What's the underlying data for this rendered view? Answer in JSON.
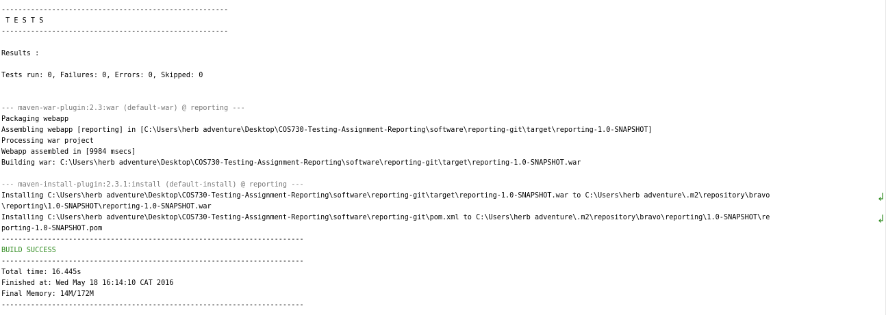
{
  "console": {
    "lines": [
      {
        "text": "------------------------------------------------------",
        "style": "normal"
      },
      {
        "text": " T E S T S",
        "style": "normal"
      },
      {
        "text": "------------------------------------------------------",
        "style": "normal"
      },
      {
        "text": "",
        "style": "normal"
      },
      {
        "text": "Results :",
        "style": "normal"
      },
      {
        "text": "",
        "style": "normal"
      },
      {
        "text": "Tests run: 0, Failures: 0, Errors: 0, Skipped: 0",
        "style": "normal"
      },
      {
        "text": "",
        "style": "normal"
      },
      {
        "text": "",
        "style": "normal"
      },
      {
        "text": "--- maven-war-plugin:2.3:war (default-war) @ reporting ---",
        "style": "gray"
      },
      {
        "text": "Packaging webapp",
        "style": "normal"
      },
      {
        "text": "Assembling webapp [reporting] in [C:\\Users\\herb adventure\\Desktop\\COS730-Testing-Assignment-Reporting\\software\\reporting-git\\target\\reporting-1.0-SNAPSHOT]",
        "style": "normal"
      },
      {
        "text": "Processing war project",
        "style": "normal"
      },
      {
        "text": "Webapp assembled in [9984 msecs]",
        "style": "normal"
      },
      {
        "text": "Building war: C:\\Users\\herb adventure\\Desktop\\COS730-Testing-Assignment-Reporting\\software\\reporting-git\\target\\reporting-1.0-SNAPSHOT.war",
        "style": "normal"
      },
      {
        "text": "",
        "style": "normal"
      },
      {
        "text": "--- maven-install-plugin:2.3.1:install (default-install) @ reporting ---",
        "style": "gray"
      },
      {
        "text": "Installing C:\\Users\\herb adventure\\Desktop\\COS730-Testing-Assignment-Reporting\\software\\reporting-git\\target\\reporting-1.0-SNAPSHOT.war to C:\\Users\\herb adventure\\.m2\\repository\\bravo",
        "style": "normal",
        "wrapped": true
      },
      {
        "text": "\\reporting\\1.0-SNAPSHOT\\reporting-1.0-SNAPSHOT.war",
        "style": "normal"
      },
      {
        "text": "Installing C:\\Users\\herb adventure\\Desktop\\COS730-Testing-Assignment-Reporting\\software\\reporting-git\\pom.xml to C:\\Users\\herb adventure\\.m2\\repository\\bravo\\reporting\\1.0-SNAPSHOT\\re",
        "style": "normal",
        "wrapped": true
      },
      {
        "text": "porting-1.0-SNAPSHOT.pom",
        "style": "normal"
      },
      {
        "text": "------------------------------------------------------------------------",
        "style": "normal"
      },
      {
        "text": "BUILD SUCCESS",
        "style": "success"
      },
      {
        "text": "------------------------------------------------------------------------",
        "style": "normal"
      },
      {
        "text": "Total time: 16.445s",
        "style": "normal"
      },
      {
        "text": "Finished at: Wed May 18 16:14:10 CAT 2016",
        "style": "normal"
      },
      {
        "text": "Final Memory: 14M/172M",
        "style": "normal"
      },
      {
        "text": "------------------------------------------------------------------------",
        "style": "normal"
      }
    ],
    "colors": {
      "text": "#000000",
      "plugin_header": "#777777",
      "build_success": "#2e8b1e",
      "wrap_marker": "#2e8b1e"
    },
    "wrap_marker_icon": "line-wrap-icon"
  }
}
